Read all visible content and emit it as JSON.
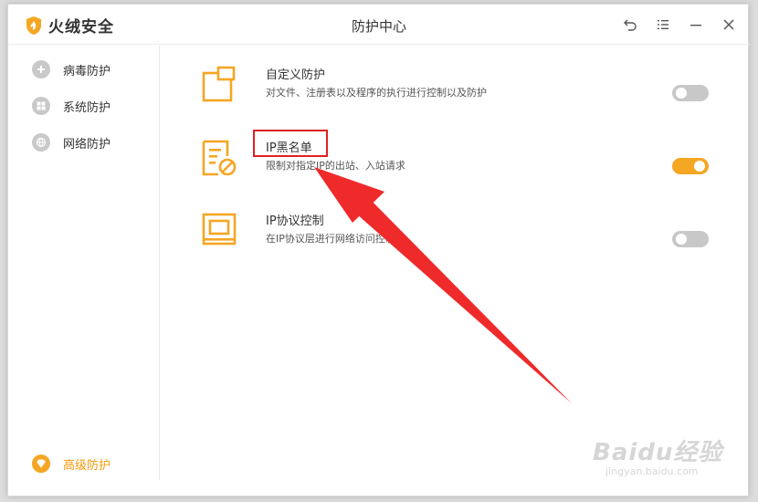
{
  "app": {
    "name": "火绒安全",
    "title": "防护中心"
  },
  "sidebar": {
    "items": [
      {
        "label": "病毒防护"
      },
      {
        "label": "系统防护"
      },
      {
        "label": "网络防护"
      }
    ],
    "advanced": {
      "label": "高级防护"
    }
  },
  "features": [
    {
      "name": "自定义防护",
      "desc": "对文件、注册表以及程序的执行进行控制以及防护",
      "enabled": false
    },
    {
      "name": "IP黑名单",
      "desc": "限制对指定IP的出站、入站请求",
      "enabled": true
    },
    {
      "name": "IP协议控制",
      "desc": "在IP协议层进行网络访问控制",
      "enabled": false
    }
  ],
  "watermark": {
    "main": "Baidu经验",
    "sub": "jingyan.baidu.com"
  },
  "colors": {
    "accent": "#f5a623",
    "toggle_off": "#c8c8c8",
    "annotation": "#e02020"
  }
}
